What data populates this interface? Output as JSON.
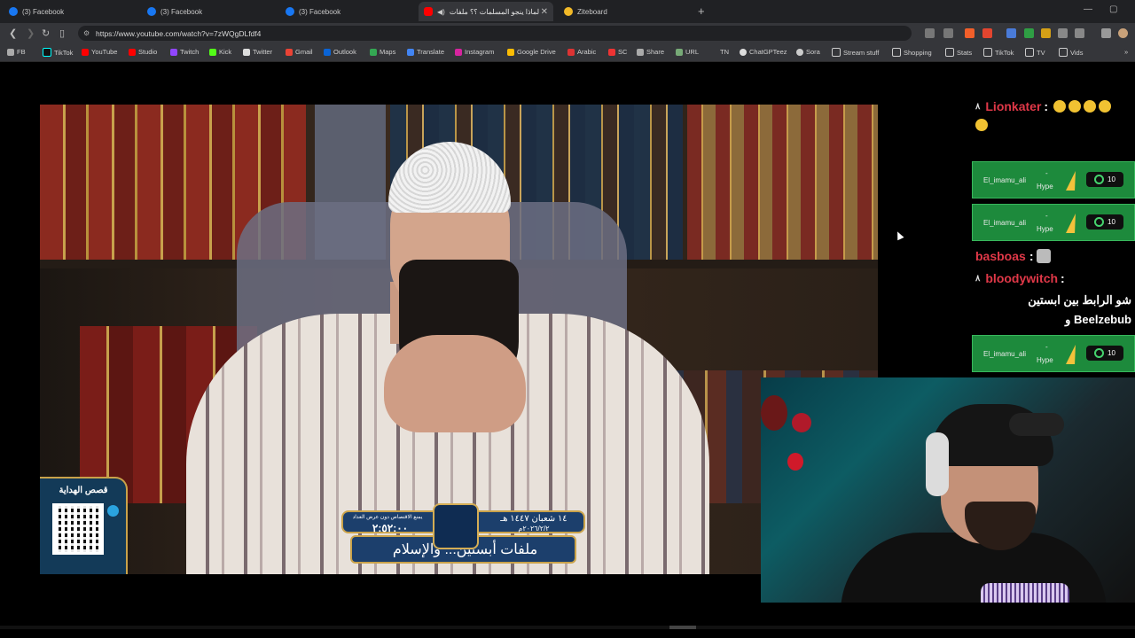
{
  "browser": {
    "tabs": [
      {
        "title": "(3) Facebook",
        "icon": "facebook-icon",
        "active": false
      },
      {
        "title": "(3) Facebook",
        "icon": "facebook-icon",
        "active": false
      },
      {
        "title": "(3) Facebook",
        "icon": "facebook-icon",
        "active": false
      },
      {
        "title": "لماذا ينجو المسلمات ؟؟ ملفات",
        "icon": "youtube-icon",
        "active": true
      },
      {
        "title": "Ziteboard",
        "icon": "ziteboard-icon",
        "active": false
      }
    ],
    "url": "https://www.youtube.com/watch?v=7zWQgDLfdf4",
    "bookmarks": [
      "FB",
      "TikTok",
      "YouTube",
      "Studio",
      "Twitch",
      "Kick",
      "Twitter",
      "Gmail",
      "Outlook",
      "Maps",
      "Translate",
      "Instagram",
      "Google Drive",
      "Arabic",
      "SC",
      "Share",
      "URL",
      "TN",
      "ChatGPTeez",
      "Sora",
      "Stream stuff",
      "Shopping",
      "Stats",
      "TikTok",
      "TV",
      "Vids"
    ]
  },
  "video": {
    "qr_label": "قصص الهداية",
    "offer_text": "يمنع الاقتصاص دون عرض العداد",
    "timer": "٢:٥٢:٠٠",
    "date_hijri": "١٤ شعبان ١٤٤٧ هـ",
    "date_gregorian": "٢٠٢٦/٢/٢م",
    "title": "ملفات أبستين... والإسلام"
  },
  "chat": {
    "line1_user": "Lionkater",
    "line1_sep": ":",
    "line1_badge": "٨",
    "hype_events": [
      {
        "user": "El_imamu_ali",
        "dash": "-",
        "label": "Hype",
        "amount": "10"
      },
      {
        "user": "El_imamu_ali",
        "dash": "-",
        "label": "Hype",
        "amount": "10"
      },
      {
        "user": "El_imamu_ali",
        "dash": "-",
        "label": "Hype",
        "amount": "10"
      }
    ],
    "line2_user": "basboas",
    "line2_sep": ":",
    "line3_badge": "٨",
    "line3_user": "bloodywitch",
    "line3_sep": ":",
    "message": "شو الرابط بين ابستين Beelzebub و"
  },
  "colors": {
    "chat_user_color": "#e03848",
    "hype_bg": "#1d8a3c",
    "tab_bg": "#202124",
    "toolbar_bg": "#35363a"
  }
}
